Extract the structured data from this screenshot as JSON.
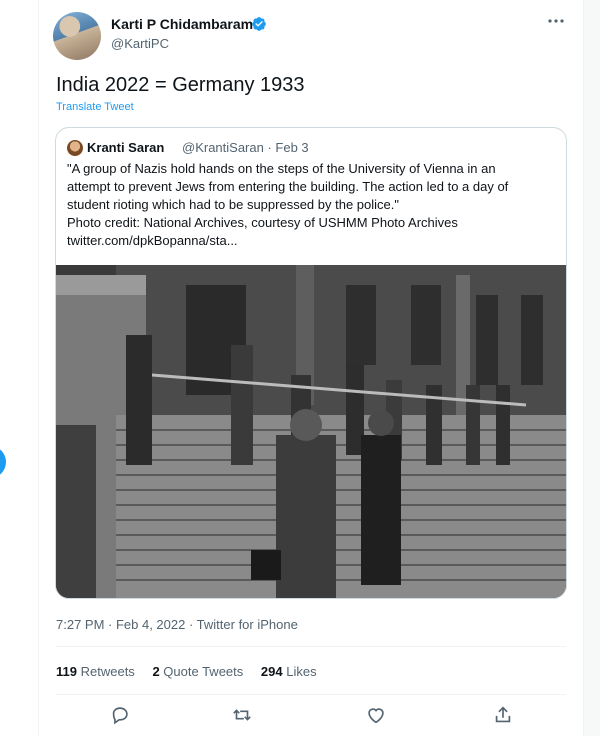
{
  "author": {
    "display_name": "Karti P Chidambaram",
    "handle": "@KartiPC",
    "verified_icon": "verified-badge-icon"
  },
  "tweet": {
    "text": "India 2022 = Germany 1933",
    "translate_label": "Translate Tweet",
    "timestamp": "7:27 PM · Feb 4, 2022 · Twitter for iPhone"
  },
  "quoted": {
    "display_name": "Kranti Saran",
    "handle_date": "@KrantiSaran · Feb 3",
    "lines": [
      "\"A group of Nazis hold hands on the steps of the University of Vienna in an",
      "attempt to prevent Jews from entering the building. The action led to a day of",
      "student rioting which had to be suppressed by the police.\"",
      "Photo credit: National Archives, courtesy of USHMM Photo Archives",
      "twitter.com/dpkBopanna/sta..."
    ]
  },
  "stats": {
    "retweets_count": "119",
    "retweets_label": "Retweets",
    "quotes_count": "2",
    "quotes_label": "Quote Tweets",
    "likes_count": "294",
    "likes_label": "Likes"
  },
  "actions": [
    "reply-icon",
    "retweet-icon",
    "like-icon",
    "share-icon"
  ],
  "colors": {
    "accent": "#1d9bf0",
    "text": "#0f1419",
    "secondary": "#536471",
    "border": "#cfd9de"
  }
}
